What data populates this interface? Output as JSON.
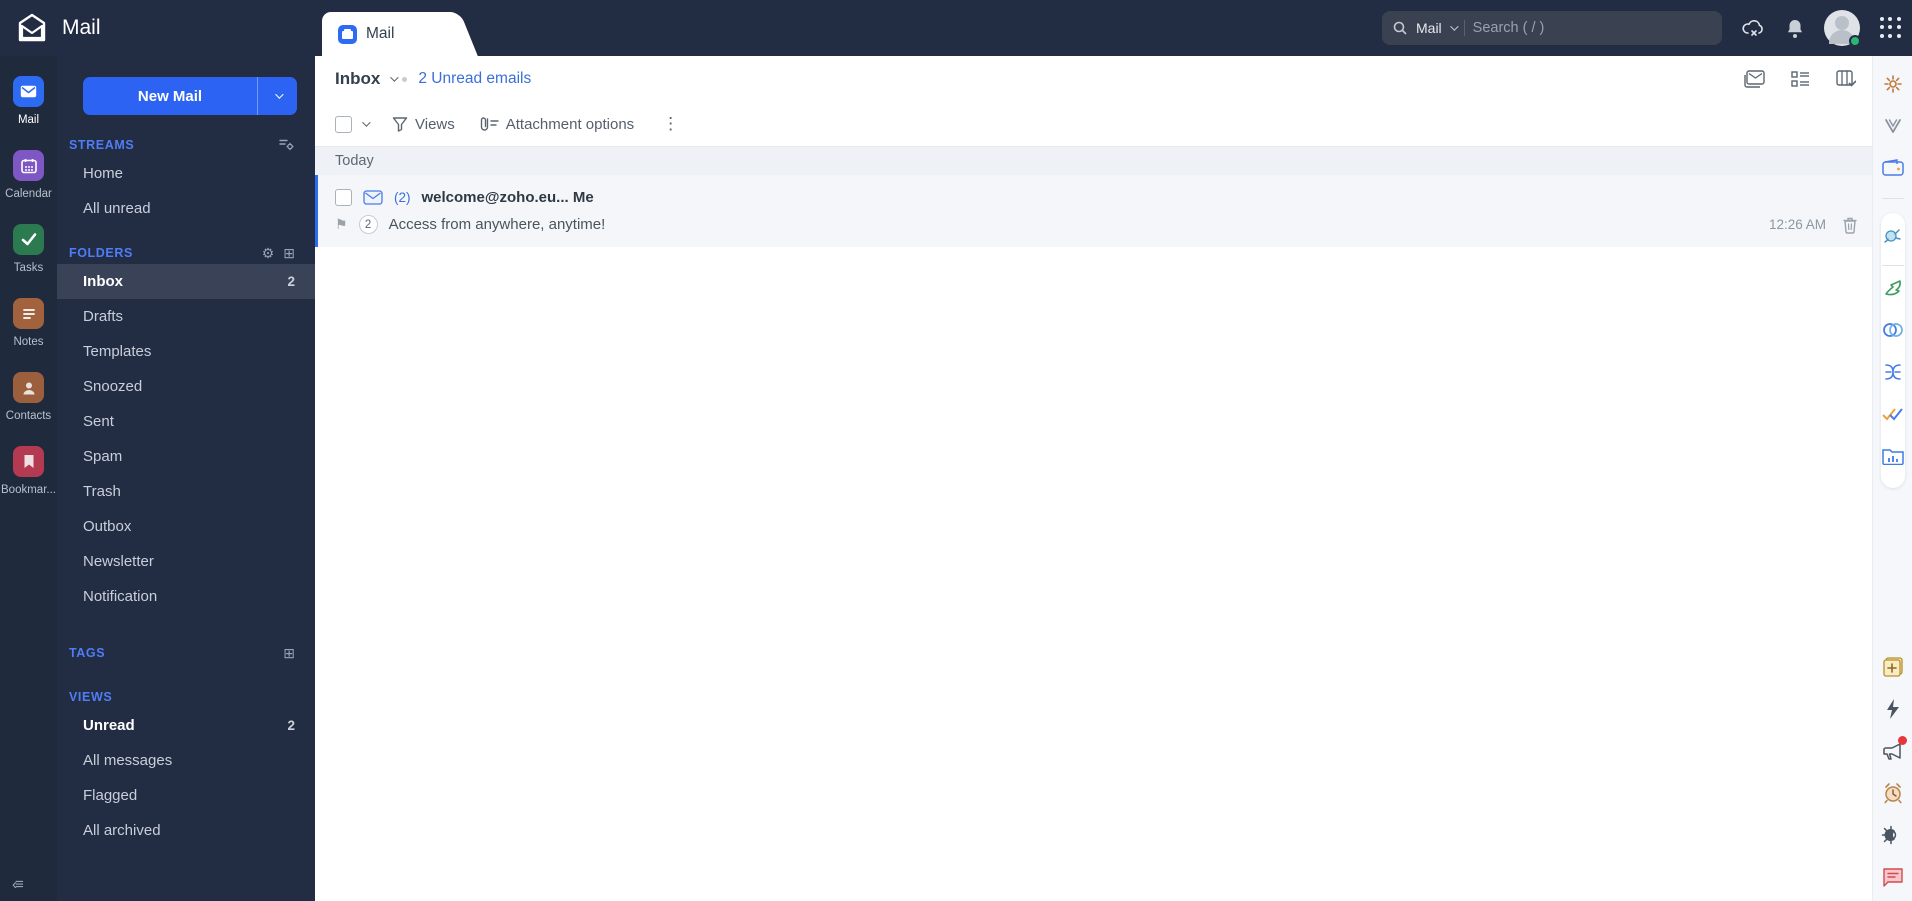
{
  "colors": {
    "topbar_bg": "#222c42",
    "appstrip_bg": "#202a3d",
    "nav_bg": "#222c42",
    "accent_blue": "#2d6bf2",
    "section_title_blue": "#4f7df5",
    "link_blue": "#3b6fd9",
    "selected_row_bg": "#394257",
    "email_row_bg": "#f4f6f9",
    "group_bar_bg": "#eef1f5",
    "rail_bg": "#f5f7fa",
    "status_green": "#2bb673"
  },
  "topbar": {
    "app_title": "Mail",
    "search": {
      "scope": "Mail",
      "placeholder": "Search ( / )"
    },
    "icons": [
      "search-icon",
      "cloud-offline-icon",
      "bell-icon",
      "avatar",
      "apps-grid-icon"
    ]
  },
  "tab": {
    "label": "Mail"
  },
  "app_strip": {
    "items": [
      {
        "label": "Mail",
        "icon": "mail-app-icon",
        "color": "#2d6bf2",
        "active": true
      },
      {
        "label": "Calendar",
        "icon": "calendar-app-icon",
        "color": "#7e57c5",
        "active": false
      },
      {
        "label": "Tasks",
        "icon": "tasks-app-icon",
        "color": "#2c7a50",
        "active": false
      },
      {
        "label": "Notes",
        "icon": "notes-app-icon",
        "color": "#a2623d",
        "active": false
      },
      {
        "label": "Contacts",
        "icon": "contacts-app-icon",
        "color": "#9c5f3e",
        "active": false
      },
      {
        "label": "Bookmar...",
        "icon": "bookmarks-app-icon",
        "color": "#b43a52",
        "active": false
      }
    ],
    "collapse_glyph": "‹≡"
  },
  "sidebar": {
    "new_mail": "New Mail",
    "streams": {
      "title": "STREAMS",
      "items": [
        {
          "label": "Home"
        },
        {
          "label": "All unread"
        }
      ]
    },
    "folders": {
      "title": "FOLDERS",
      "items": [
        {
          "label": "Inbox",
          "count": "2"
        },
        {
          "label": "Drafts"
        },
        {
          "label": "Templates"
        },
        {
          "label": "Snoozed"
        },
        {
          "label": "Sent"
        },
        {
          "label": "Spam"
        },
        {
          "label": "Trash"
        },
        {
          "label": "Outbox"
        },
        {
          "label": "Newsletter"
        },
        {
          "label": "Notification"
        }
      ],
      "gear_glyph": "⚙",
      "add_glyph": "⊞"
    },
    "tags": {
      "title": "TAGS",
      "add_glyph": "⊞"
    },
    "views": {
      "title": "VIEWS",
      "items": [
        {
          "label": "Unread",
          "count": "2"
        },
        {
          "label": "All messages"
        },
        {
          "label": "Flagged"
        },
        {
          "label": "All archived"
        }
      ]
    }
  },
  "main": {
    "folder_name": "Inbox",
    "unread_link": "2 Unread emails",
    "toolbar": {
      "views_label": "Views",
      "attachment_label": "Attachment options",
      "ellipsis_glyph": "⋮"
    },
    "view_icons": [
      "reading-pane-icon",
      "list-view-icon",
      "column-view-icon"
    ],
    "group_header": "Today",
    "emails": [
      {
        "thread_count": "(2)",
        "sender": "welcome@zoho.eu... Me",
        "badge": "2",
        "subject": "Access from anywhere, anytime!",
        "time": "12:26 AM",
        "flag_glyph": "⚑"
      }
    ]
  },
  "right_rail": {
    "icons_top": [
      "settings-gear-icon",
      "zoho-clip-icon",
      "wallet-icon"
    ],
    "icons_pill": [
      "plug-icon",
      "sign-swoosh-icon",
      "crm-rings-icon",
      "knot-icon",
      "double-check-icon",
      "folder-chart-icon"
    ],
    "icons_bottom": [
      "note-add-icon",
      "lightning-icon",
      "announce-icon",
      "alarm-icon",
      "theme-toggle-icon",
      "feedback-icon"
    ]
  }
}
